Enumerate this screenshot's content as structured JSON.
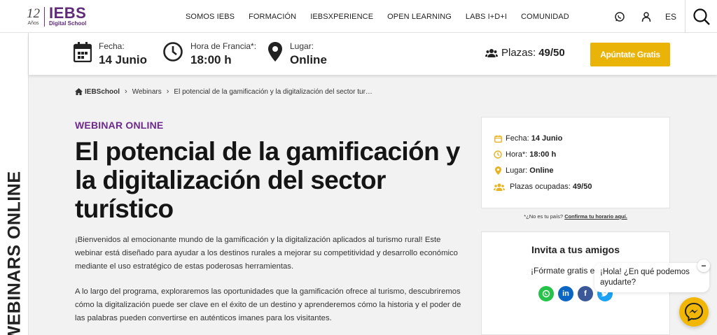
{
  "logo": {
    "years_num": "12",
    "years_label": "Años",
    "brand": "IEBS",
    "subtitle": "Digital School"
  },
  "nav": {
    "items": [
      "SOMOS IEBS",
      "FORMACIÓN",
      "IEBSXPERIENCE",
      "OPEN LEARNING",
      "LABS I+D+I",
      "COMUNIDAD"
    ],
    "lang": "ES",
    "icons": [
      "whatsapp-icon",
      "user-icon",
      "search-icon"
    ]
  },
  "sidebar": {
    "vertical_text": "WEBINARS ONLINE"
  },
  "infobar": {
    "fecha_label": "Fecha:",
    "fecha_value": "14 Junio",
    "hora_label": "Hora de Francia*:",
    "hora_value": "18:00 h",
    "lugar_label": "Lugar:",
    "lugar_value": "Online",
    "plazas_label": "Plazas:",
    "plazas_value": "49/50",
    "cta_label": "Apúntate Gratis"
  },
  "breadcrumb": {
    "home": "IEBSchool",
    "section": "Webinars",
    "current": "El potencial de la gamificación y la digitalización del sector tur…"
  },
  "main": {
    "kicker": "WEBINAR ONLINE",
    "title": "El potencial de la gamificación y la digitalización del sector turístico",
    "paragraph1": "¡Bienvenidos al emocionante mundo de la gamificación y la digitalización aplicados al turismo rural! Este webinar está diseñado para ayudar a los destinos rurales a mejorar su competitividad y desarrollo económico mediante el uso estratégico de estas poderosas herramientas.",
    "paragraph2": "A lo largo del programa, exploraremos las oportunidades que la gamificación ofrece al turismo, descubriremos cómo la digitalización puede ser clave en el éxito de un destino y aprenderemos cómo la historia y el poder de las palabras pueden convertirse en auténticos imanes para los visitantes."
  },
  "card": {
    "fecha_label": "Fecha:",
    "fecha_value": "14 Junio",
    "hora_label": "Hora*:",
    "hora_value": "18:00 h",
    "lugar_label": "Lugar:",
    "lugar_value": "Online",
    "plazas_label": "Plazas ocupadas:",
    "plazas_value": "49/50"
  },
  "timezone": {
    "question": "*¿No es tu país?",
    "link": "Confirma tu horario aquí."
  },
  "invite": {
    "title": "Invita a tus amigos",
    "subtitle": "¡Fórmate gratis er"
  },
  "chat": {
    "message": "¡Hola! ¿En qué podemos ayudarte?",
    "close": "−"
  },
  "colors": {
    "brand_purple": "#6b2a8c",
    "cta_yellow": "#eab308",
    "icon_gold": "#e8b320"
  }
}
